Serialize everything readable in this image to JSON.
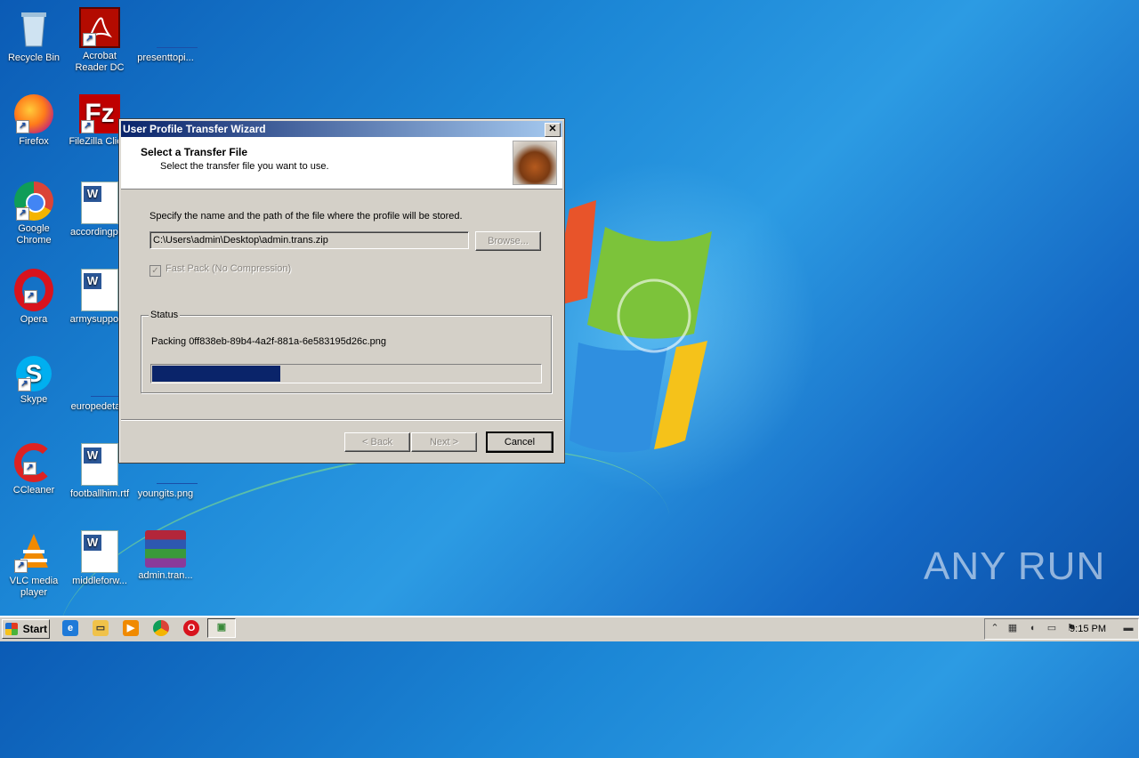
{
  "desktop": {
    "icons": [
      {
        "label": "Recycle Bin",
        "icon": "recycle-bin-icon"
      },
      {
        "label": "Acrobat Reader DC",
        "icon": "acrobat-icon"
      },
      {
        "label": "presenttopi...",
        "icon": "file-icon"
      },
      {
        "label": "Firefox",
        "icon": "firefox-icon"
      },
      {
        "label": "FileZilla Clie...",
        "icon": "filezilla-icon"
      },
      {
        "label": "Google Chrome",
        "icon": "chrome-icon"
      },
      {
        "label": "accordingpr...",
        "icon": "word-doc-icon"
      },
      {
        "label": "Opera",
        "icon": "opera-icon"
      },
      {
        "label": "armysuppor...",
        "icon": "word-doc-icon"
      },
      {
        "label": "Skype",
        "icon": "skype-icon"
      },
      {
        "label": "europedeta...",
        "icon": "file-icon"
      },
      {
        "label": "CCleaner",
        "icon": "ccleaner-icon"
      },
      {
        "label": "footballhim.rtf",
        "icon": "word-doc-icon"
      },
      {
        "label": "youngits.png",
        "icon": "image-file-icon"
      },
      {
        "label": "VLC media player",
        "icon": "vlc-icon"
      },
      {
        "label": "middleforw...",
        "icon": "word-doc-icon"
      },
      {
        "label": "admin.tran...",
        "icon": "winrar-icon"
      }
    ]
  },
  "dialog": {
    "title": "User Profile Transfer Wizard",
    "close": "✕",
    "header_title": "Select a Transfer File",
    "header_subtitle": "Select the transfer file you want to use.",
    "specify_label": "Specify the name and the path of the file where the profile will be stored.",
    "path_value": "C:\\Users\\admin\\Desktop\\admin.trans.zip",
    "browse_label": "Browse...",
    "fastpack_label": "Fast Pack (No Compression)",
    "fastpack_checked": true,
    "status_legend": "Status",
    "packing_text": "Packing 0ff838eb-89b4-4a2f-881a-6e583195d26c.png",
    "progress_fraction": 0.33,
    "back_label": "< Back",
    "next_label": "Next >",
    "cancel_label": "Cancel"
  },
  "taskbar": {
    "start_label": "Start",
    "clock": "9:15 PM"
  },
  "watermark": "ANY RUN",
  "colors": {
    "progress_fill": "#0a246a",
    "title_gradient_start": "#0a246a",
    "title_gradient_end": "#a6caf0"
  }
}
